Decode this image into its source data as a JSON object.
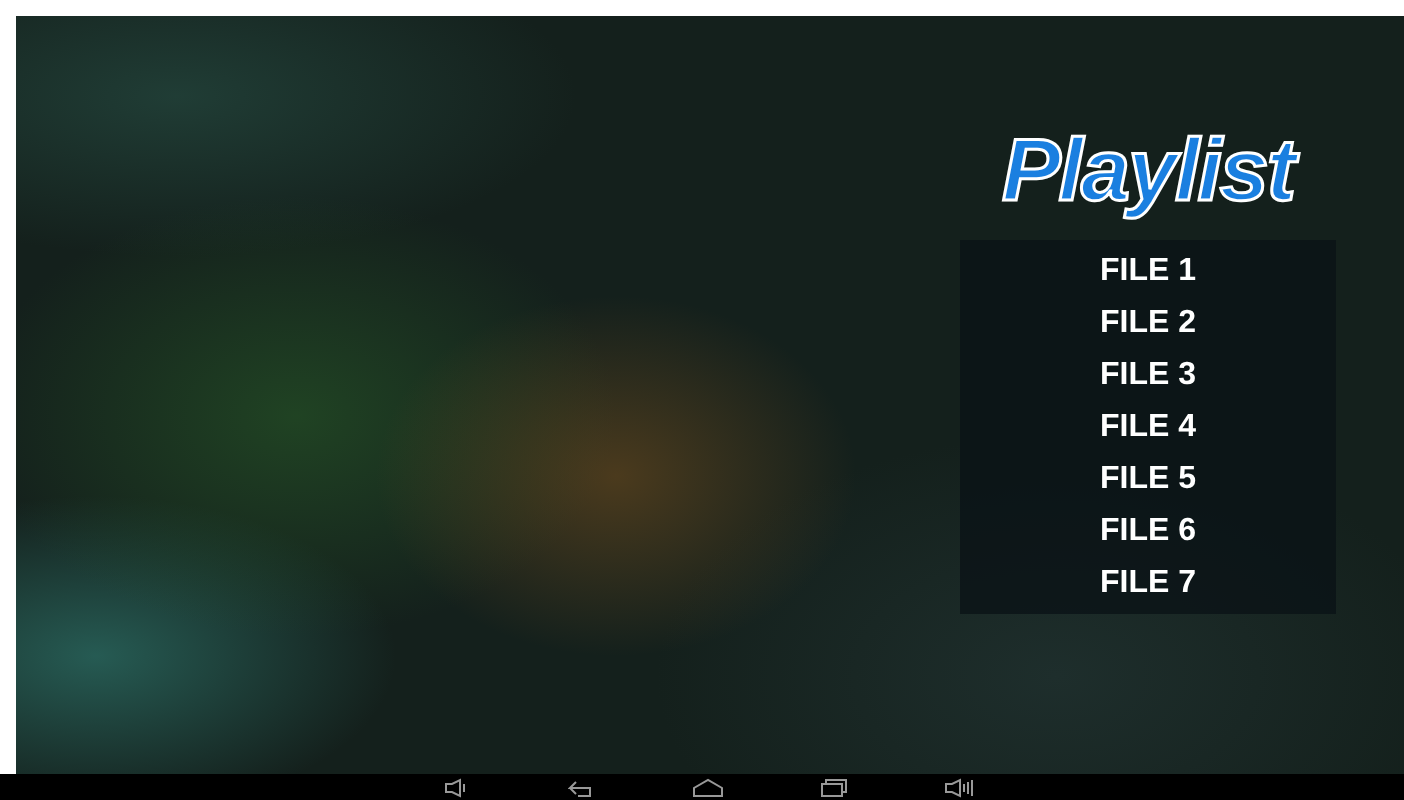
{
  "title": "Playlist",
  "files": [
    {
      "label": "FILE 1"
    },
    {
      "label": "FILE 2"
    },
    {
      "label": "FILE 3"
    },
    {
      "label": "FILE 4"
    },
    {
      "label": "FILE 5"
    },
    {
      "label": "FILE 6"
    },
    {
      "label": "FILE 7"
    }
  ]
}
